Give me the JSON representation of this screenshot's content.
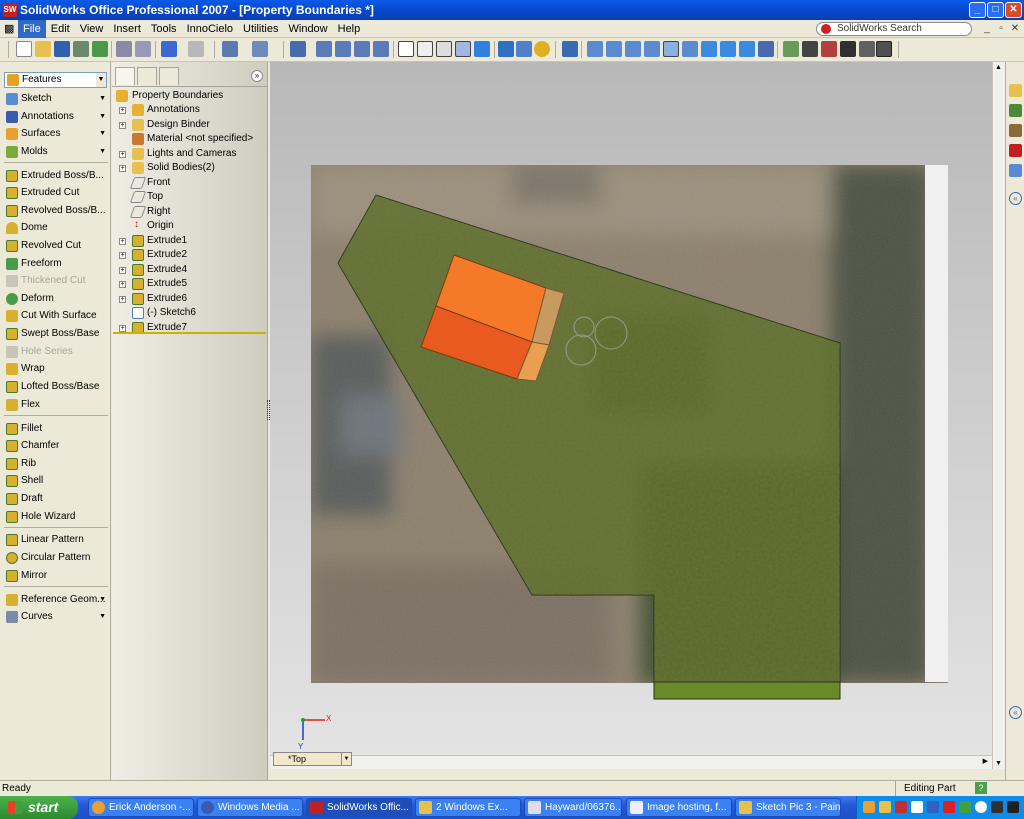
{
  "window": {
    "title": "SolidWorks Office Professional 2007 - [Property Boundaries *]",
    "app_icon": "SW"
  },
  "menu": {
    "items": [
      "File",
      "Edit",
      "View",
      "Insert",
      "Tools",
      "InnoCielo",
      "Utilities",
      "Window",
      "Help"
    ],
    "search_placeholder": "SolidWorks Search"
  },
  "command_manager": {
    "selected_group": "Features",
    "groups": [
      "Sketch",
      "Annotations",
      "Surfaces",
      "Molds"
    ],
    "commands": [
      {
        "label": "Extruded Boss/B...",
        "enabled": true
      },
      {
        "label": "Extruded Cut",
        "enabled": true
      },
      {
        "label": "Revolved Boss/B...",
        "enabled": true
      },
      {
        "label": "Dome",
        "enabled": true
      },
      {
        "label": "Revolved Cut",
        "enabled": true
      },
      {
        "label": "Freeform",
        "enabled": true
      },
      {
        "label": "Thickened Cut",
        "enabled": false
      },
      {
        "label": "Deform",
        "enabled": true
      },
      {
        "label": "Cut With Surface",
        "enabled": true
      },
      {
        "label": "Swept Boss/Base",
        "enabled": true
      },
      {
        "label": "Hole Series",
        "enabled": false
      },
      {
        "label": "Wrap",
        "enabled": true
      },
      {
        "label": "Lofted Boss/Base",
        "enabled": true
      },
      {
        "label": "Flex",
        "enabled": true
      },
      {
        "label": "Fillet",
        "enabled": true
      },
      {
        "label": "Chamfer",
        "enabled": true
      },
      {
        "label": "Rib",
        "enabled": true
      },
      {
        "label": "Shell",
        "enabled": true
      },
      {
        "label": "Draft",
        "enabled": true
      },
      {
        "label": "Hole Wizard",
        "enabled": true
      },
      {
        "label": "Linear Pattern",
        "enabled": true
      },
      {
        "label": "Circular Pattern",
        "enabled": true
      },
      {
        "label": "Mirror",
        "enabled": true
      },
      {
        "label": "Reference Geom...",
        "enabled": true
      },
      {
        "label": "Curves",
        "enabled": true
      }
    ]
  },
  "feature_tree": {
    "root": "Property Boundaries",
    "nodes": [
      {
        "label": "Annotations",
        "expandable": true
      },
      {
        "label": "Design Binder",
        "expandable": true
      },
      {
        "label": "Material <not specified>",
        "expandable": false
      },
      {
        "label": "Lights and Cameras",
        "expandable": true
      },
      {
        "label": "Solid Bodies(2)",
        "expandable": true
      },
      {
        "label": "Front",
        "expandable": false
      },
      {
        "label": "Top",
        "expandable": false
      },
      {
        "label": "Right",
        "expandable": false
      },
      {
        "label": "Origin",
        "expandable": false
      },
      {
        "label": "Extrude1",
        "expandable": true
      },
      {
        "label": "Extrude2",
        "expandable": true
      },
      {
        "label": "Extrude4",
        "expandable": true
      },
      {
        "label": "Extrude5",
        "expandable": true
      },
      {
        "label": "Extrude6",
        "expandable": true
      },
      {
        "label": "(-) Sketch6",
        "expandable": false
      },
      {
        "label": "Extrude7",
        "expandable": true
      }
    ]
  },
  "viewport": {
    "view_name": "*Top",
    "axis_x": "X",
    "axis_y": "Y"
  },
  "statusbar": {
    "left": "Ready",
    "right": "Editing Part",
    "help": "?"
  },
  "taskbar": {
    "start": "start",
    "tasks": [
      {
        "label": "Erick Anderson -...",
        "active": false
      },
      {
        "label": "Windows Media ...",
        "active": false
      },
      {
        "label": "SolidWorks Offic...",
        "active": true
      },
      {
        "label": "2 Windows Ex...",
        "active": false
      },
      {
        "label": "Hayward/06376...",
        "active": false
      },
      {
        "label": "Image hosting, f...",
        "active": false
      },
      {
        "label": "Sketch Pic 3 - Paint",
        "active": false
      }
    ]
  },
  "colors": {
    "title_blue": "#0a4fd8",
    "roof_orange": "#f47a2a",
    "grass_green": "#5e6a2a"
  }
}
